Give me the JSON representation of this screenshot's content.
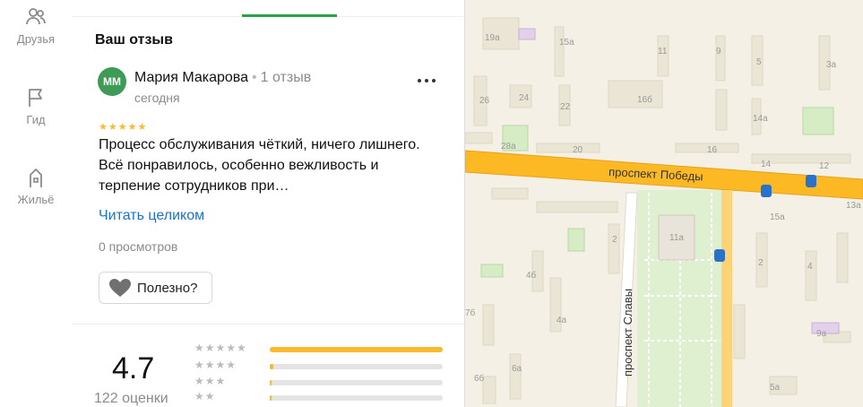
{
  "rail": {
    "friends_label": "Друзья",
    "guide_label": "Гид",
    "housing_label": "Жильё"
  },
  "review_section": {
    "title": "Ваш отзыв",
    "author_initials": "ММ",
    "author_name": "Мария Макарова",
    "author_reviews": "1 отзыв",
    "date": "сегодня",
    "stars": "★★★★★",
    "text": "Процесс обслуживания чёткий, ничего лишнего. Всё понравилось, особенно вежливость и терпение сотрудников при…",
    "read_more": "Читать целиком",
    "views": "0 просмотров",
    "useful_label": "Полезно?"
  },
  "rating": {
    "value": "4.7",
    "count_label": "122 оценки",
    "rows": [
      {
        "stars": "★★★★★",
        "fraction": 1.0
      },
      {
        "stars": "★★★★",
        "fraction": 0.02
      },
      {
        "stars": "★★★",
        "fraction": 0.01
      },
      {
        "stars": "★★",
        "fraction": 0.01
      }
    ]
  },
  "map": {
    "street_1": "проспект Победы",
    "street_2": "проспект Славы",
    "buildings": [
      "19а",
      "15а",
      "11",
      "9",
      "5",
      "3а",
      "26",
      "24",
      "16б",
      "22",
      "14а",
      "28а",
      "20",
      "16",
      "14",
      "12",
      "2",
      "11а",
      "4б",
      "4а",
      "7б",
      "6б",
      "6а",
      "9а",
      "5а",
      "2",
      "4",
      "15а",
      "13а"
    ]
  },
  "colors": {
    "accent_green": "#2aa24a",
    "avatar": "#3e9b56",
    "star": "#fbb92d",
    "link": "#1a73c9",
    "road": "#fdb924"
  }
}
